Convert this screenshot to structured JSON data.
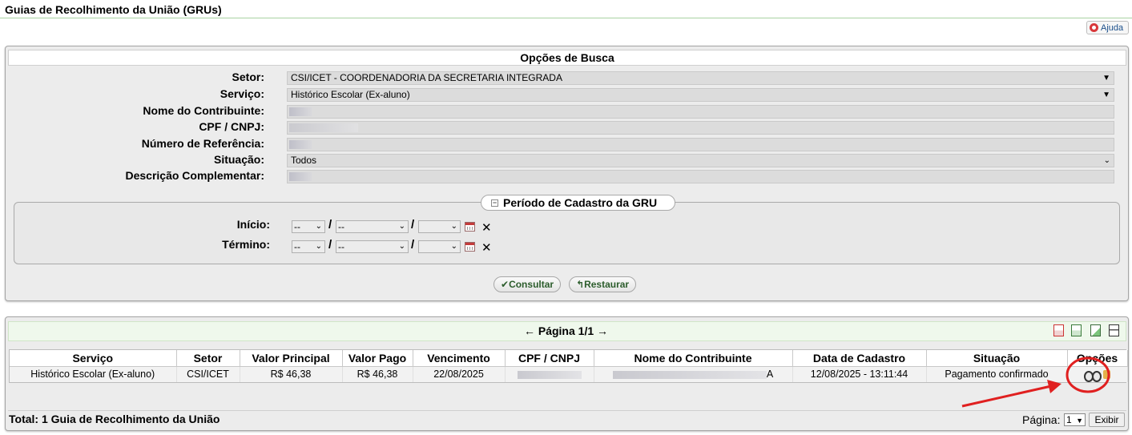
{
  "page": {
    "title": "Guias de Recolhimento da União (GRUs)",
    "help_label": "Ajuda"
  },
  "search": {
    "header": "Opções de Busca",
    "fields": {
      "setor": {
        "label": "Setor:",
        "value": "CSI/ICET - COORDENADORIA DA SECRETARIA INTEGRADA"
      },
      "servico": {
        "label": "Serviço:",
        "value": "Histórico Escolar (Ex-aluno)"
      },
      "nome": {
        "label": "Nome do Contribuinte:",
        "value": ""
      },
      "cpf": {
        "label": "CPF / CNPJ:",
        "value": ""
      },
      "referencia": {
        "label": "Número de Referência:",
        "value": ""
      },
      "situacao": {
        "label": "Situação:",
        "value": "Todos"
      },
      "descricao": {
        "label": "Descrição Complementar:",
        "value": ""
      }
    },
    "periodo": {
      "legend": "Período de Cadastro da GRU",
      "inicio_label": "Início:",
      "termino_label": "Término:",
      "day_value": "--",
      "month_value": "--",
      "year_value": "",
      "separator": "/",
      "clear_symbol": "✕"
    },
    "buttons": {
      "consultar": "Consultar",
      "restaurar": "Restaurar"
    }
  },
  "results": {
    "pagination": "← Página 1/1 →",
    "columns": [
      "Serviço",
      "Setor",
      "Valor Principal",
      "Valor Pago",
      "Vencimento",
      "CPF / CNPJ",
      "Nome do Contribuinte",
      "Data de Cadastro",
      "Situação",
      "Opções"
    ],
    "rows": [
      {
        "servico": "Histórico Escolar (Ex-aluno)",
        "setor": "CSI/ICET",
        "valor_principal": "R$ 46,38",
        "valor_pago": "R$ 46,38",
        "vencimento": "22/08/2025",
        "cpf": "",
        "nome": "A",
        "data_cadastro": "12/08/2025 - 13:11:44",
        "situacao": "Pagamento confirmado"
      }
    ],
    "total": "Total: 1 Guia de Recolhimento da União",
    "page_label": "Página:",
    "page_value": "1",
    "exibir": "Exibir",
    "export_icons": [
      "pdf-icon",
      "excel-icon",
      "chart-icon",
      "print-icon"
    ]
  },
  "colors": {
    "annotation": "#e02020",
    "header_rule": "#a9d3a2",
    "button_text": "#2c5d2c"
  }
}
